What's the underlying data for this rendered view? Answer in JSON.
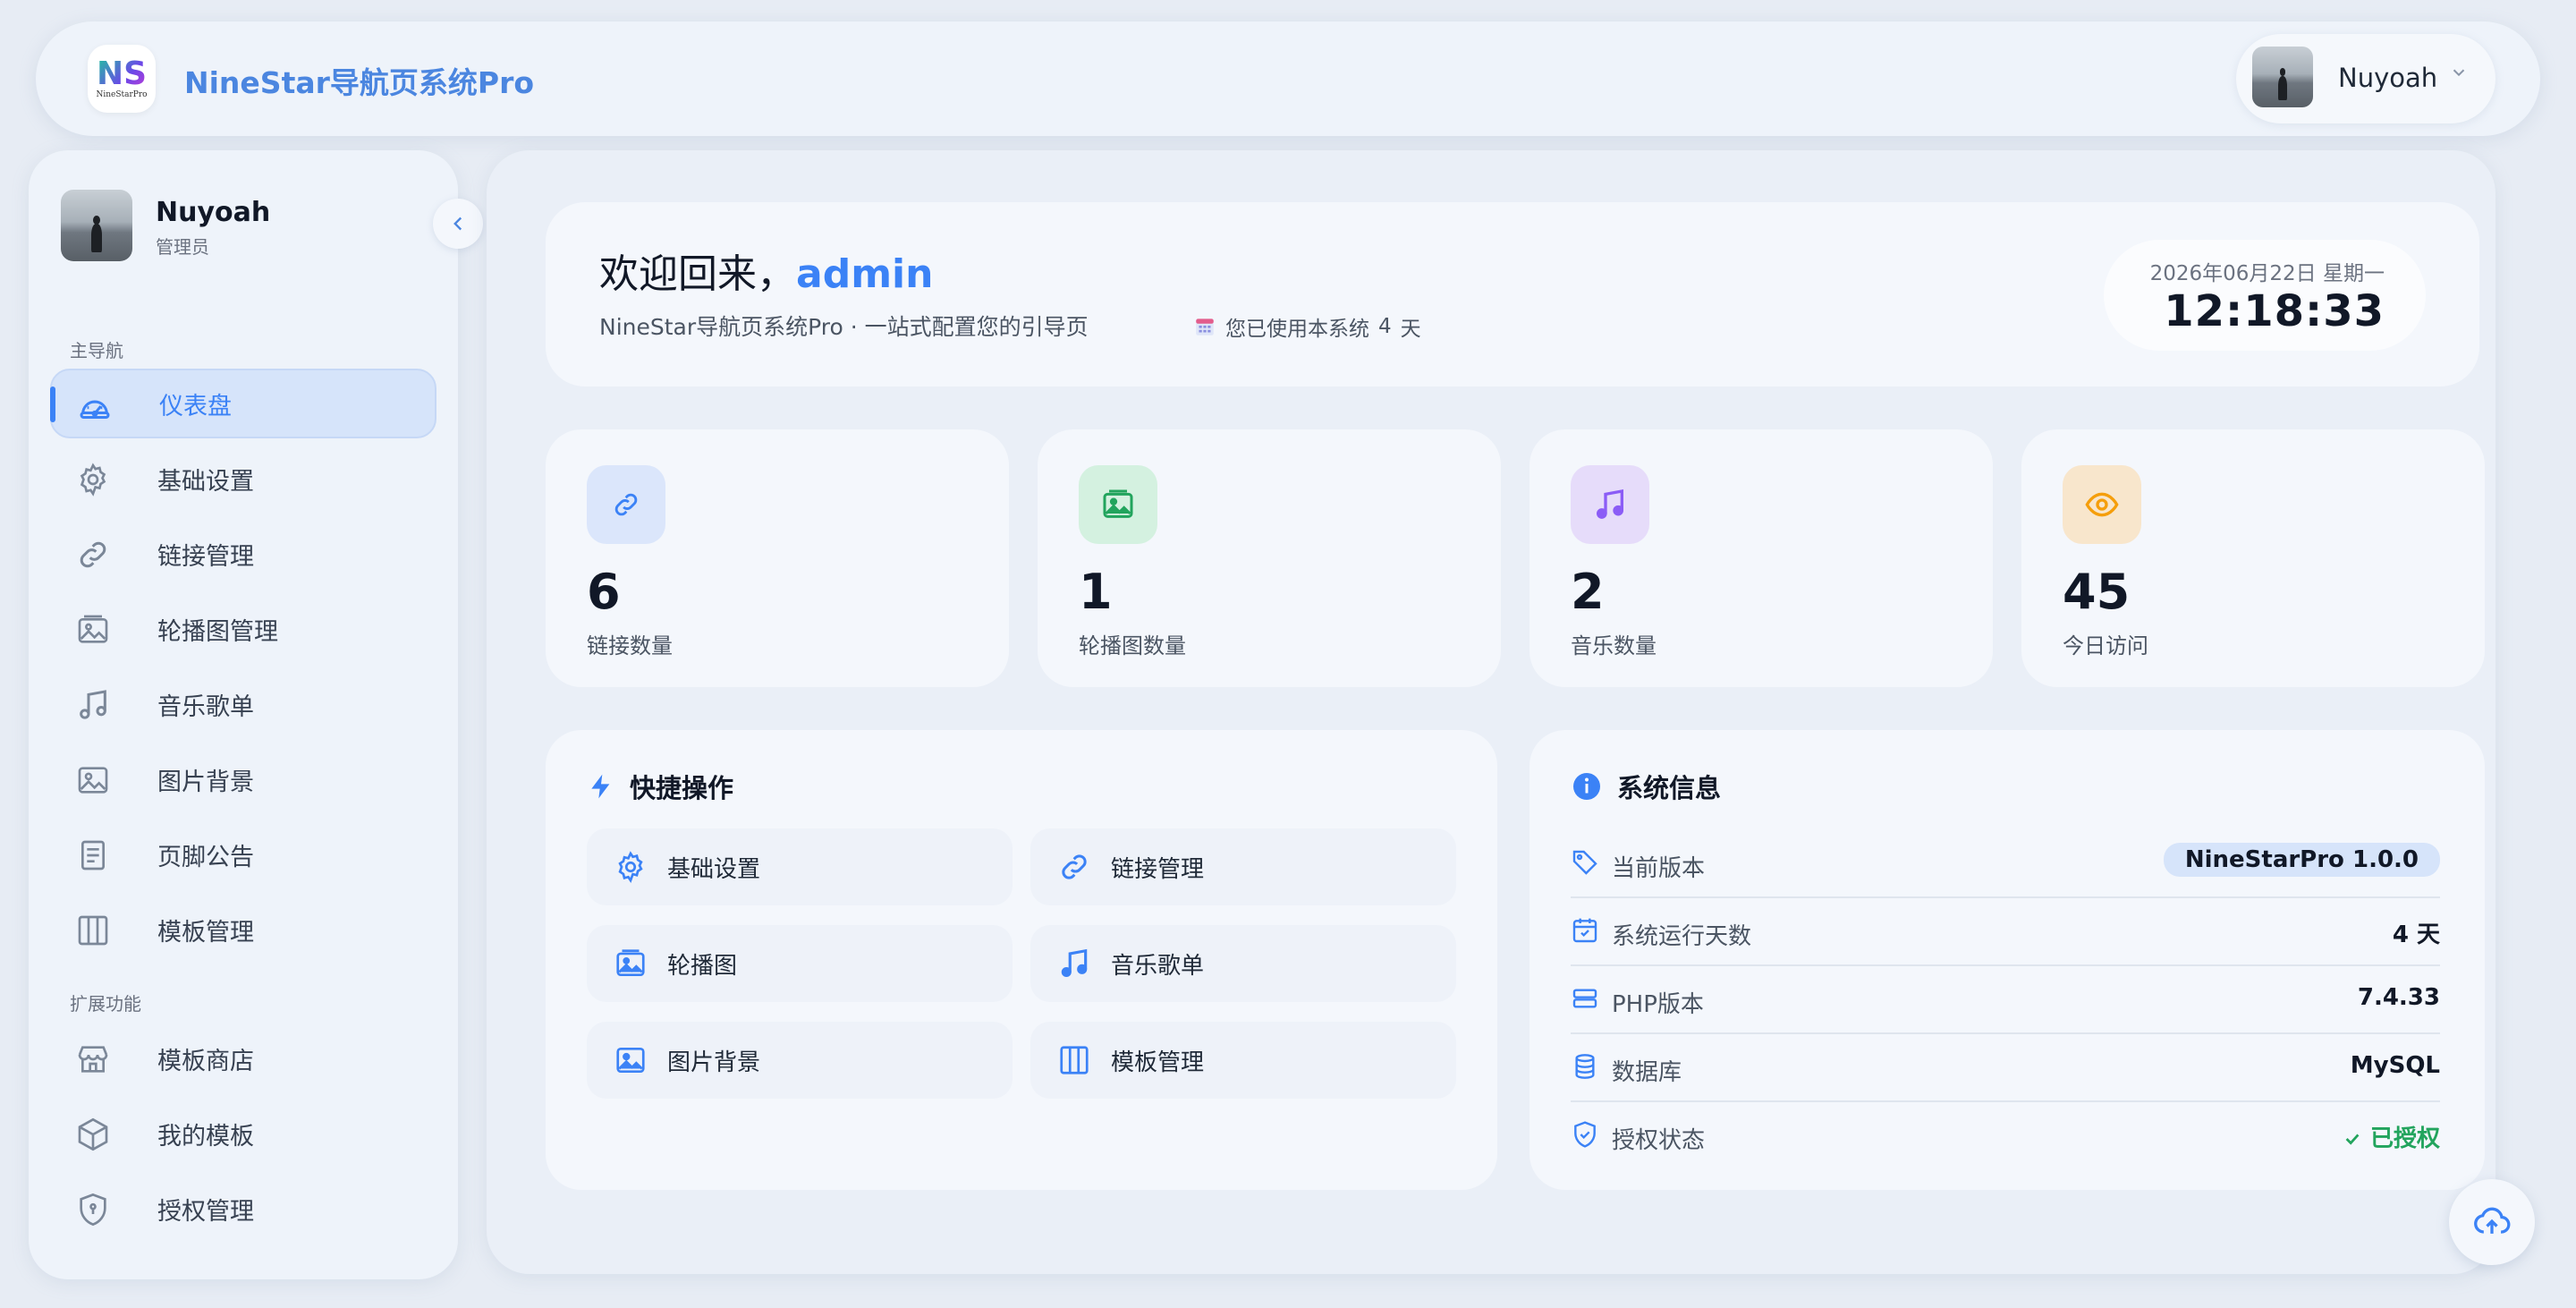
{
  "header": {
    "logo_text": "NS",
    "logo_sub": "NineStarPro",
    "app_title": "NineStar导航页系统Pro",
    "user_name": "Nuyoah"
  },
  "sidebar": {
    "user_name": "Nuyoah",
    "user_role": "管理员",
    "section_main": "主导航",
    "section_ext": "扩展功能",
    "items": [
      {
        "label": "仪表盘",
        "icon": "dashboard-icon",
        "active": true
      },
      {
        "label": "基础设置",
        "icon": "gear-icon"
      },
      {
        "label": "链接管理",
        "icon": "link-icon"
      },
      {
        "label": "轮播图管理",
        "icon": "carousel-icon"
      },
      {
        "label": "音乐歌单",
        "icon": "music-icon"
      },
      {
        "label": "图片背景",
        "icon": "image-icon"
      },
      {
        "label": "页脚公告",
        "icon": "document-icon"
      },
      {
        "label": "模板管理",
        "icon": "columns-icon"
      }
    ],
    "ext_items": [
      {
        "label": "模板商店",
        "icon": "store-icon"
      },
      {
        "label": "我的模板",
        "icon": "box-icon"
      },
      {
        "label": "授权管理",
        "icon": "shield-icon"
      }
    ]
  },
  "welcome": {
    "greeting": "欢迎回来，",
    "user": "admin",
    "desc": "NineStar导航页系统Pro · 一站式配置您的引导页",
    "days_text": "您已使用本系统",
    "days_num": "4",
    "days_unit": "天",
    "date": "2026年06月22日 星期一",
    "time": "12:18:33"
  },
  "stats": [
    {
      "num": "6",
      "label": "链接数量",
      "icon": "link-icon",
      "bg": "#dbe6fb",
      "fg": "#3b82f6"
    },
    {
      "num": "1",
      "label": "轮播图数量",
      "icon": "image-icon",
      "bg": "#d4f1e0",
      "fg": "#22a45d"
    },
    {
      "num": "2",
      "label": "音乐数量",
      "icon": "music-icon",
      "bg": "#e6dcfa",
      "fg": "#8b5cf6"
    },
    {
      "num": "45",
      "label": "今日访问",
      "icon": "eye-icon",
      "bg": "#f8e6cc",
      "fg": "#f59e0b"
    }
  ],
  "quick": {
    "title": "快捷操作",
    "items": [
      {
        "label": "基础设置",
        "icon": "gear-icon"
      },
      {
        "label": "链接管理",
        "icon": "link-icon"
      },
      {
        "label": "轮播图",
        "icon": "carousel-icon"
      },
      {
        "label": "音乐歌单",
        "icon": "music-icon"
      },
      {
        "label": "图片背景",
        "icon": "image-icon"
      },
      {
        "label": "模板管理",
        "icon": "columns-icon"
      }
    ]
  },
  "sysinfo": {
    "title": "系统信息",
    "rows": [
      {
        "key": "当前版本",
        "value": "NineStarPro 1.0.0",
        "icon": "tag-icon"
      },
      {
        "key": "系统运行天数",
        "value": "4 天",
        "icon": "calendar-icon"
      },
      {
        "key": "PHP版本",
        "value": "7.4.33",
        "icon": "server-icon"
      },
      {
        "key": "数据库",
        "value": "MySQL",
        "icon": "database-icon"
      },
      {
        "key": "授权状态",
        "value": "已授权",
        "icon": "shield-check-icon"
      }
    ]
  },
  "colors": {
    "accent": "#3b82f6",
    "success": "#22a45d"
  }
}
